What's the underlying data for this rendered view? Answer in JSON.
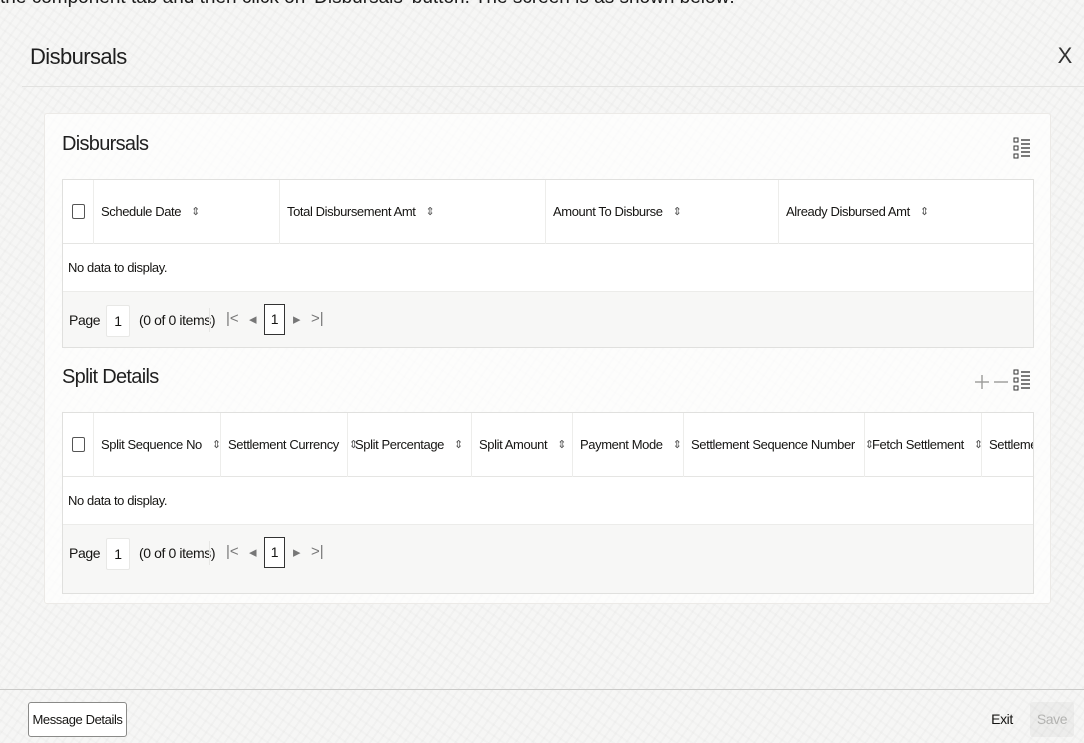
{
  "caption_text": "the component tab and then click on 'Disbursals' button. The screen is as shown below:",
  "window": {
    "title": "Disbursals",
    "close_label": "X"
  },
  "disbursals": {
    "title": "Disbursals",
    "columns": [
      "Schedule Date",
      "Total Disbursement Amt",
      "Amount To Disburse",
      "Already Disbursed Amt"
    ],
    "empty_text": "No data to display.",
    "pager": {
      "label": "Page",
      "page_value": "1",
      "count_text": "(0 of 0 items)",
      "current_page": "1"
    }
  },
  "split_details": {
    "title": "Split Details",
    "columns": [
      "Split Sequence No",
      "Settlement Currency",
      "Split Percentage",
      "Split Amount",
      "Payment Mode",
      "Settlement Sequence Number",
      "Fetch Settlement",
      "Settlemen"
    ],
    "empty_text": "No data to display.",
    "pager": {
      "label": "Page",
      "page_value": "1",
      "count_text": "(0 of 0 items)",
      "current_page": "1"
    }
  },
  "footer": {
    "message_details_label": "Message Details",
    "exit_label": "Exit",
    "save_label": "Save"
  },
  "icons": {
    "sort": "⇕",
    "first": "|<",
    "prev": "◂",
    "next": "▸",
    "last": ">|"
  }
}
